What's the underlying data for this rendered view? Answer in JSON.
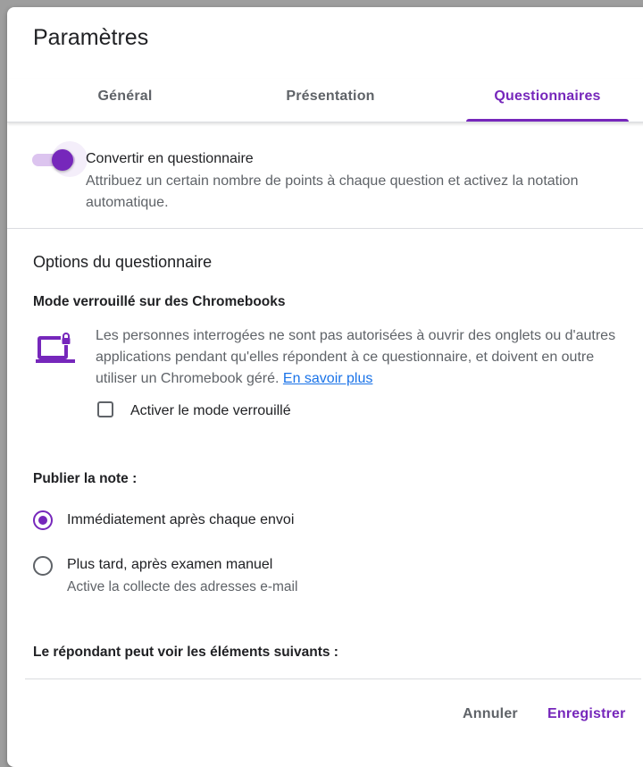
{
  "dialog": {
    "title": "Paramètres"
  },
  "tabs": [
    {
      "label": "Général",
      "active": false
    },
    {
      "label": "Présentation",
      "active": false
    },
    {
      "label": "Questionnaires",
      "active": true
    }
  ],
  "convert": {
    "enabled": true,
    "label": "Convertir en questionnaire",
    "description": "Attribuez un certain nombre de points à chaque question et activez la notation automatique."
  },
  "quiz_options": {
    "title": "Options du questionnaire",
    "locked_mode": {
      "heading": "Mode verrouillé sur des Chromebooks",
      "icon": "laptop-lock-icon",
      "description": "Les personnes interrogées ne sont pas autorisées à ouvrir des onglets ou d'autres applications pendant qu'elles répondent à ce questionnaire, et doivent en outre utiliser un Chromebook géré.",
      "learn_more": "En savoir plus",
      "checkbox_label": "Activer le mode verrouillé",
      "checked": false
    },
    "publish_grade": {
      "heading": "Publier la note :",
      "options": [
        {
          "label": "Immédiatement après chaque envoi",
          "checked": true
        },
        {
          "label": "Plus tard, après examen manuel",
          "sub": "Active la collecte des adresses e-mail",
          "checked": false
        }
      ]
    },
    "respondent_can_see": {
      "heading": "Le répondant peut voir les éléments suivants :"
    }
  },
  "footer": {
    "cancel": "Annuler",
    "save": "Enregistrer"
  },
  "colors": {
    "accent": "#7627bb",
    "link": "#1a73e8",
    "text": "#202124",
    "secondary": "#5f6368"
  }
}
